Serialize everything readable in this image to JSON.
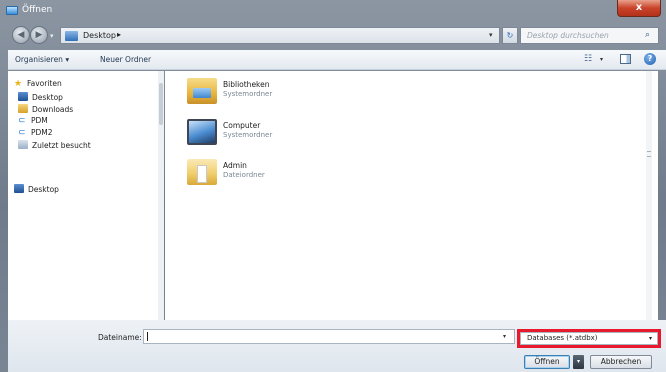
{
  "window": {
    "title": "Öffnen",
    "close_label": "x"
  },
  "nav": {
    "back_label": "◀",
    "fwd_label": "▶",
    "dropdown": "▾",
    "breadcrumb": "Desktop",
    "breadcrumb_sep": "▸",
    "address_dd": "▾",
    "refresh_label": "↻",
    "search_placeholder": "Desktop durchsuchen",
    "search_icon": "⌕"
  },
  "toolbar": {
    "organize_label": "Organisieren ▾",
    "new_folder_label": "Neuer Ordner",
    "view_icon": "☷",
    "view_dd": "▾",
    "help_label": "?"
  },
  "sidebar": {
    "items": [
      {
        "label": "Favoriten",
        "icon": "star-icon"
      },
      {
        "label": "Desktop",
        "icon": "desktop-icon"
      },
      {
        "label": "Downloads",
        "icon": "downloads-icon"
      },
      {
        "label": "PDM",
        "icon": "pdm-icon"
      },
      {
        "label": "PDM2",
        "icon": "pdm-icon"
      },
      {
        "label": "Zuletzt besucht",
        "icon": "recent-icon"
      },
      {
        "label": "Desktop",
        "icon": "desktop-icon"
      }
    ]
  },
  "content": {
    "items": [
      {
        "name": "Bibliotheken",
        "type": "Systemordner",
        "icon": "libraries-icon"
      },
      {
        "name": "Computer",
        "type": "Systemordner",
        "icon": "computer-icon"
      },
      {
        "name": "Admin",
        "type": "Dateiordner",
        "icon": "folder-icon"
      }
    ]
  },
  "footer": {
    "filename_label": "Dateiname:",
    "filename_value": "",
    "filename_dd": "▾",
    "filter_value": "Databases (*.atdbx)",
    "filter_dd": "▾",
    "open_label": "Öffnen",
    "open_split": "▾",
    "cancel_label": "Abbrechen"
  },
  "colors": {
    "highlight": "#e8192c",
    "accent": "#2f6fb8"
  }
}
